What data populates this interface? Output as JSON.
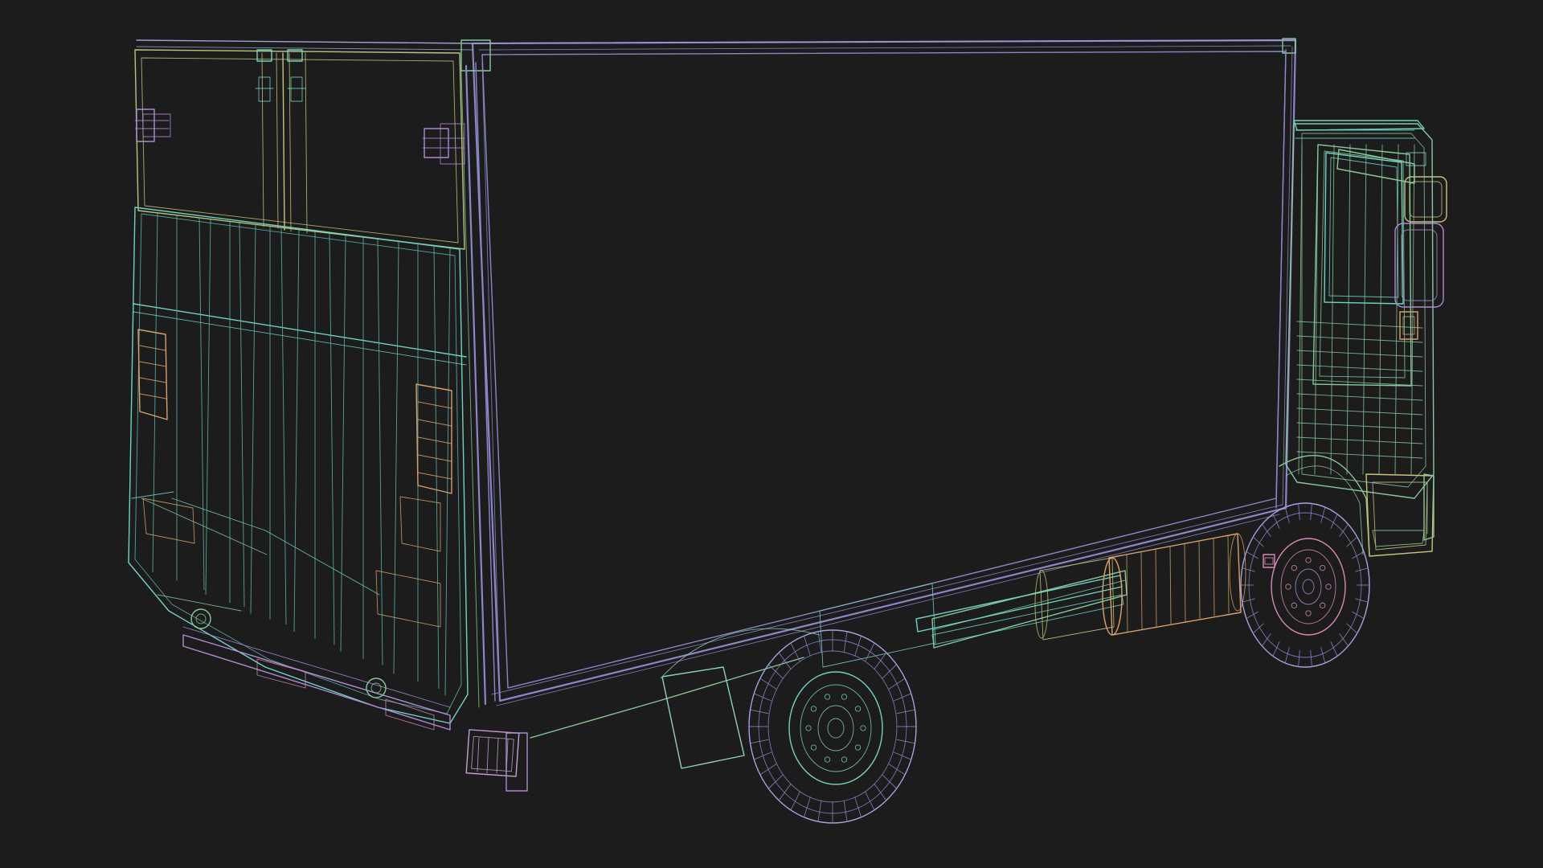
{
  "scene": {
    "subject": "truck-wireframe",
    "background_color": "#1c1c1c"
  },
  "palette": {
    "box": "#8a86c8",
    "box_light": "#a7a3e0",
    "cyan": "#6fd3c4",
    "green": "#86c89a",
    "yellow": "#c8c27a",
    "orange": "#d9a06b",
    "purple": "#b08ad6",
    "pink": "#d98ab8",
    "teal": "#5fb8b0"
  }
}
